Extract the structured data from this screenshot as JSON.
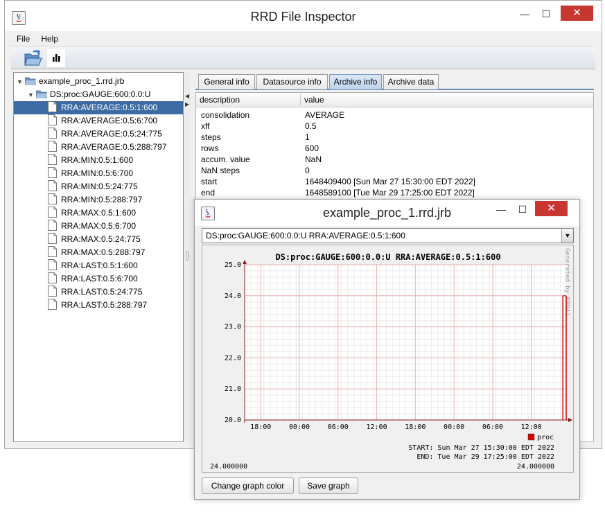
{
  "main_window": {
    "title": "RRD File Inspector",
    "controls": {
      "minimize": "—",
      "maximize": "☐",
      "close": "✕"
    },
    "menu": [
      "File",
      "Help"
    ],
    "toolbar": {
      "open_icon": "folder-open-icon",
      "graph_icon": "bar-chart-icon"
    }
  },
  "tree": {
    "root": "example_proc_1.rrd.jrb",
    "datasource": "DS:proc:GAUGE:600:0.0:U",
    "archives": [
      "RRA:AVERAGE:0.5:1:600",
      "RRA:AVERAGE:0.5:6:700",
      "RRA:AVERAGE:0.5:24:775",
      "RRA:AVERAGE:0.5:288:797",
      "RRA:MIN:0.5:1:600",
      "RRA:MIN:0.5:6:700",
      "RRA:MIN:0.5:24:775",
      "RRA:MIN:0.5:288:797",
      "RRA:MAX:0.5:1:600",
      "RRA:MAX:0.5:6:700",
      "RRA:MAX:0.5:24:775",
      "RRA:MAX:0.5:288:797",
      "RRA:LAST:0.5:1:600",
      "RRA:LAST:0.5:6:700",
      "RRA:LAST:0.5:24:775",
      "RRA:LAST:0.5:288:797"
    ],
    "selected_index": 0
  },
  "tabs": [
    "General info",
    "Datasource info",
    "Archive info",
    "Archive data"
  ],
  "active_tab": "Archive info",
  "archive_table": {
    "headers": [
      "description",
      "value"
    ],
    "rows": [
      [
        "consolidation",
        "AVERAGE"
      ],
      [
        "xff",
        "0.5"
      ],
      [
        "steps",
        "1"
      ],
      [
        "rows",
        "600"
      ],
      [
        "accum. value",
        "NaN"
      ],
      [
        "NaN steps",
        "0"
      ],
      [
        "start",
        "1648409400 [Sun Mar 27 15:30:00 EDT 2022]"
      ],
      [
        "end",
        "1648589100 [Tue Mar 29 17:25:00 EDT 2022]"
      ]
    ]
  },
  "graph_window": {
    "title": "example_proc_1.rrd.jrb",
    "selector_value": "DS:proc:GAUGE:600:0.0:U RRA:AVERAGE:0.5:1:600",
    "buttons": [
      "Change graph color",
      "Save graph"
    ],
    "colors": {
      "grid": "#e9b0b0",
      "axis": "#8b1a1a",
      "series": "#d20000"
    }
  },
  "chart_data": {
    "type": "line",
    "title": "DS:proc:GAUGE:600:0.0:U RRA:AVERAGE:0.5:1:600",
    "watermark": "Generated by RRD4J",
    "y_ticks": [
      "25.0",
      "24.0",
      "23.0",
      "22.0",
      "21.0",
      "20.0"
    ],
    "ylim": [
      20.0,
      25.0
    ],
    "x_ticks": [
      "18:00",
      "00:00",
      "06:00",
      "12:00",
      "18:00",
      "00:00",
      "06:00",
      "12:00"
    ],
    "x_tick_hours": [
      2.5,
      8.5,
      14.5,
      20.5,
      26.5,
      32.5,
      38.5,
      44.5
    ],
    "x_range_hours": [
      0,
      49.9167
    ],
    "series": [
      {
        "name": "proc",
        "color": "#d20000",
        "points": [
          [
            49.4,
            24.0
          ],
          [
            49.9167,
            24.0
          ]
        ]
      }
    ],
    "start_label": "START: Sun Mar 27 15:30:00 EDT 2022",
    "end_label": "END: Tue Mar 29 17:25:00 EDT 2022",
    "footer_left": "24.000000",
    "footer_right": "24.000000"
  }
}
